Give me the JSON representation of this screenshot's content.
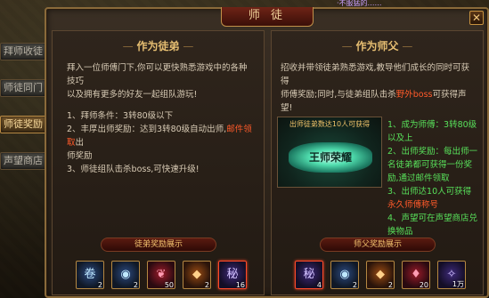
{
  "top_hud_text": "·不服猛的……",
  "sidebar": {
    "tabs": [
      {
        "label": "拜师收徒",
        "active": false
      },
      {
        "label": "师徒同门",
        "active": false
      },
      {
        "label": "师徒奖励",
        "active": true
      },
      {
        "label": "声望商店",
        "active": false
      }
    ]
  },
  "window": {
    "title": "师 徒",
    "close_label": "✕"
  },
  "left_panel": {
    "title": "作为徒弟",
    "intro_line1": "拜入一位师傅门下,你可以更快熟悉游戏中的各种技巧",
    "intro_line2": "以及拥有更多的好友一起组队游玩!",
    "item1": "1、拜师条件：3转80级以下",
    "item2_prefix": "2、丰厚出师奖励：达到3转80级自动出师,",
    "item2_highlight": "邮件领取",
    "item2_suffix": "出",
    "item2_line2": "师奖励",
    "item3": "3、师徒组队击杀boss,可快速升级!",
    "reward_title": "徒弟奖励展示",
    "rewards": [
      {
        "icon": "blue-orb-scroll-icon",
        "glyph": "卷",
        "qty": "2",
        "style": "blue"
      },
      {
        "icon": "blue-orb-icon",
        "glyph": "◉",
        "qty": "2",
        "style": "blue"
      },
      {
        "icon": "red-fruit-icon",
        "glyph": "❦",
        "qty": "50",
        "style": "red"
      },
      {
        "icon": "orange-crystal-icon",
        "glyph": "◆",
        "qty": "2",
        "style": "orange"
      },
      {
        "icon": "purple-scroll-icon",
        "glyph": "秘",
        "qty": "16",
        "style": "purple"
      }
    ]
  },
  "right_panel": {
    "title": "作为师父",
    "intro_line1": "招收并带领徒弟熟悉游戏,教导他们成长的同时可获得",
    "intro_line2_prefix": "师傅奖励;同时,与徒弟组队击杀",
    "intro_line2_highlight": "野外boss",
    "intro_line2_suffix": "可获得声望!",
    "banner_caption": "出师徒弟数达10人可获得",
    "banner_logo": "王师荣耀",
    "list": [
      "1、成为师傅：3转80级",
      "以及上",
      "2、出师奖励：每出师一",
      "名徒弟都可获得一份奖",
      "励,通过邮件领取",
      "3、出师达10人可获得",
      "永久师傅称号",
      "4、声望可在声望商店兑",
      "换物品"
    ],
    "reward_title": "师父奖励展示",
    "rewards": [
      {
        "icon": "purple-scroll-icon",
        "glyph": "秘",
        "qty": "4",
        "style": "purple"
      },
      {
        "icon": "blue-orb-icon",
        "glyph": "◉",
        "qty": "2",
        "style": "blue"
      },
      {
        "icon": "orange-crystal-icon",
        "glyph": "◆",
        "qty": "2",
        "style": "orange"
      },
      {
        "icon": "red-gem-icon",
        "glyph": "♦",
        "qty": "20",
        "style": "red"
      },
      {
        "icon": "reputation-icon",
        "glyph": "✧",
        "qty": "1万",
        "style": "purple"
      }
    ]
  }
}
